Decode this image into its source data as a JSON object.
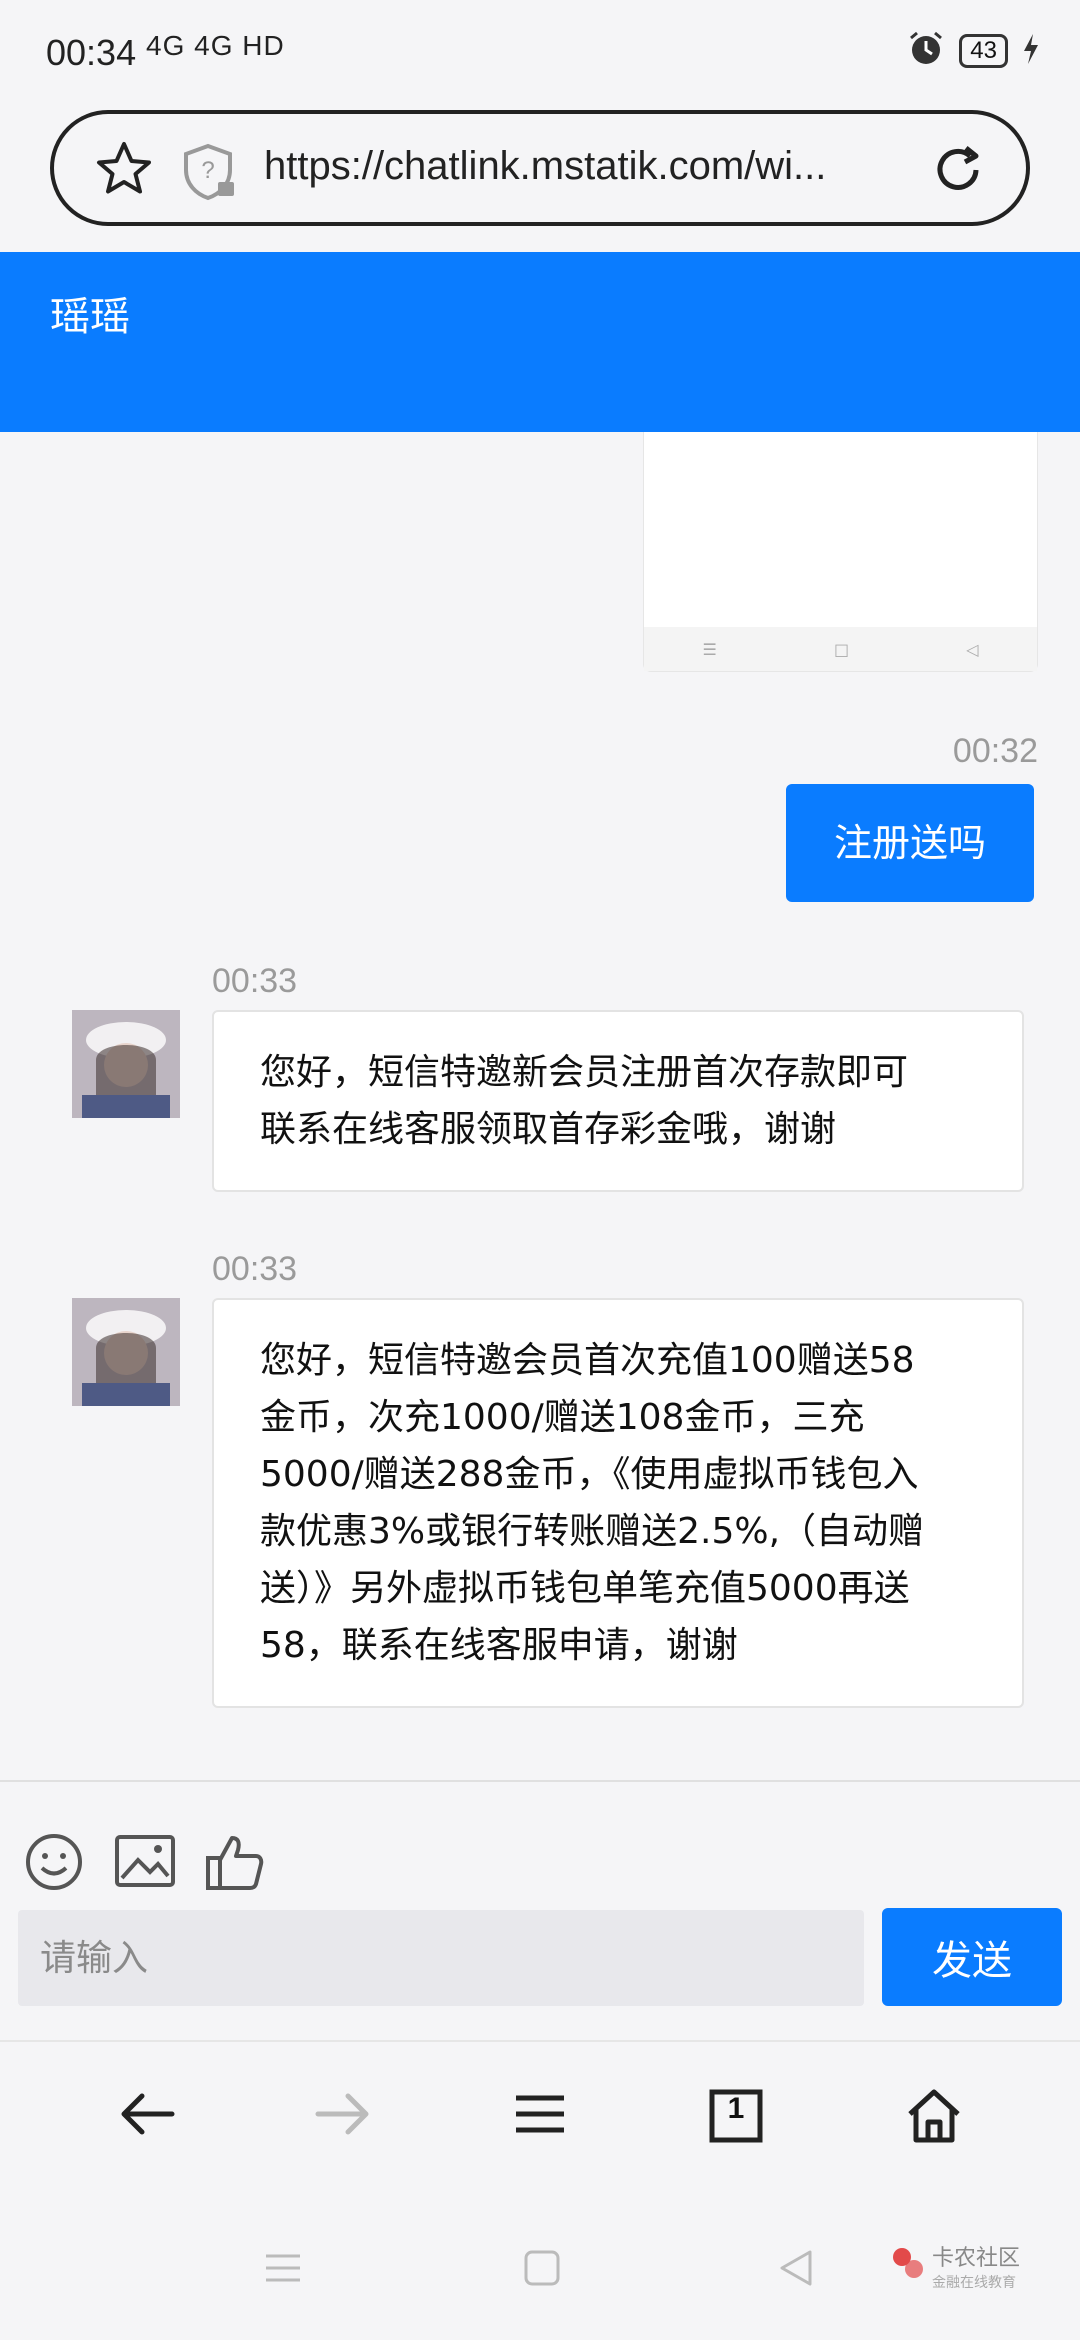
{
  "status_bar": {
    "time": "00:34",
    "signal": "4G 4G HD",
    "battery": "43"
  },
  "browser": {
    "url": "https://chatlink.mstatik.com/wi..."
  },
  "header": {
    "title": "瑶瑶"
  },
  "messages": [
    {
      "direction": "out",
      "time": "00:32",
      "text": "注册送吗"
    },
    {
      "direction": "in",
      "time": "00:33",
      "lines": [
        "您好，短信特邀新会员注册首次存款即可",
        "联系在线客服领取首存彩金哦，谢谢"
      ]
    },
    {
      "direction": "in",
      "time": "00:33",
      "lines": [
        "您好，短信特邀会员首次充值100赠送58",
        "金币，次充1000/赠送108金币，三充",
        "5000/赠送288金币，《使用虚拟币钱包入",
        "款优惠3%或银行转账赠送2.5%,（自动赠",
        "送）》另外虚拟币钱包单笔充值5000再送",
        "58，联系在线客服申请，谢谢"
      ]
    }
  ],
  "composer": {
    "placeholder": "请输入",
    "send_label": "发送"
  },
  "browser_toolbar": {
    "tab_count": "1"
  },
  "watermark": {
    "text": "卡农社区",
    "sub": "金融在线教育"
  },
  "colors": {
    "accent": "#0a7cff",
    "background": "#f5f5f7"
  }
}
